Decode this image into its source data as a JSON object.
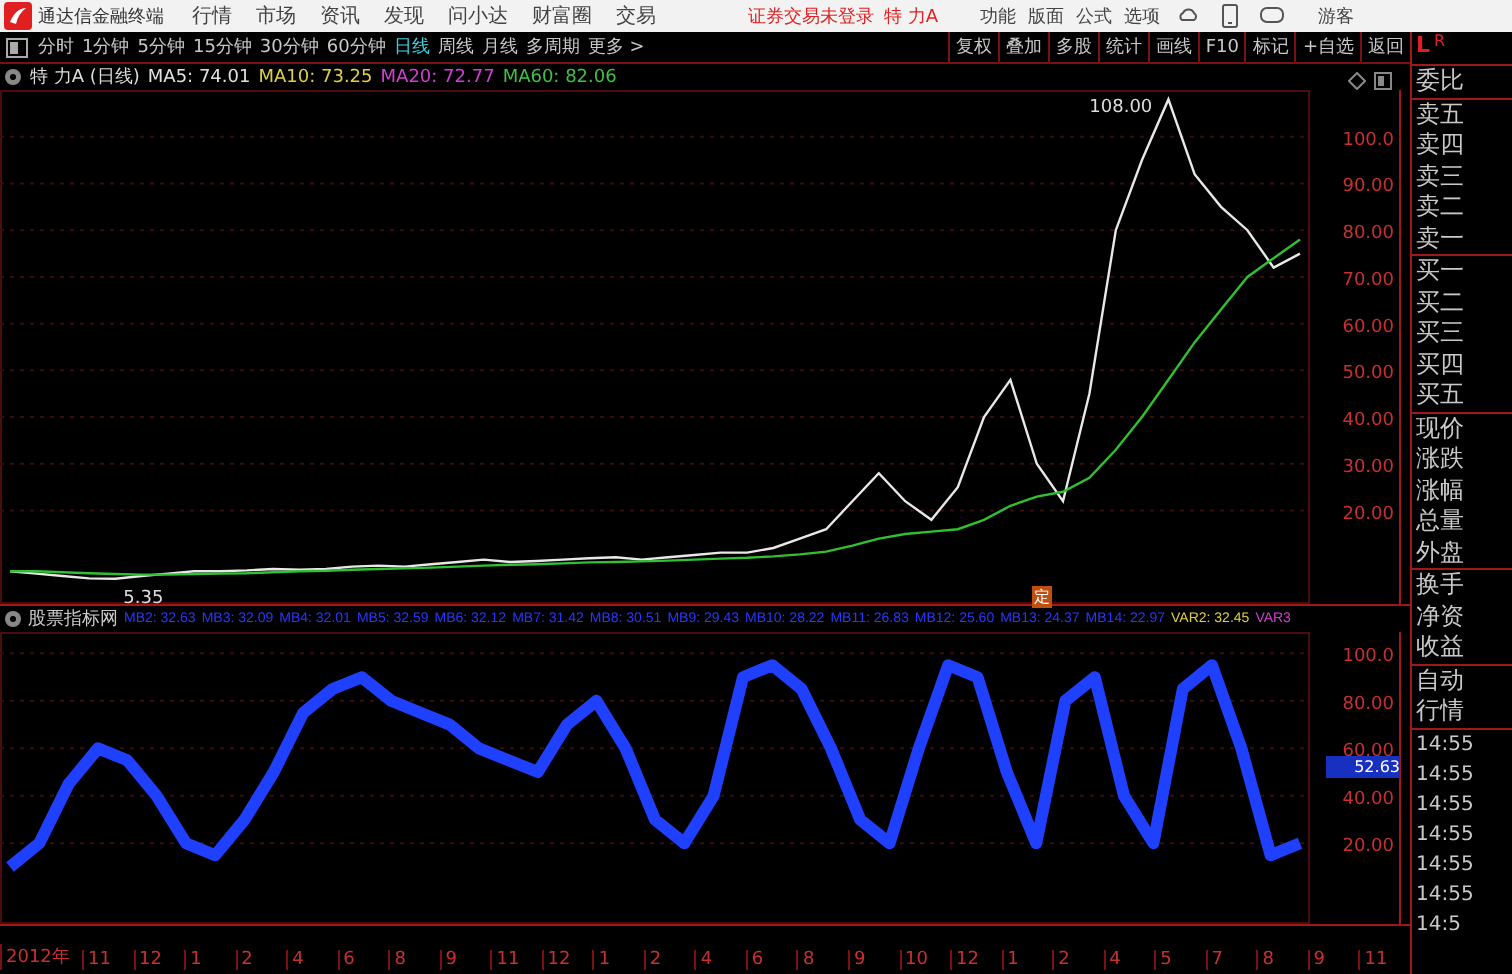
{
  "menubar": {
    "app_title": "通达信金融终端",
    "menu": [
      "行情",
      "市场",
      "资讯",
      "发现",
      "问小达",
      "财富圈",
      "交易"
    ],
    "notice": "证券交易未登录",
    "stock": "特 力A",
    "tools": [
      "功能",
      "版面",
      "公式",
      "选项"
    ],
    "user": "游客"
  },
  "toolbar": {
    "periods": [
      {
        "label": "分时",
        "selected": false
      },
      {
        "label": "1分钟",
        "selected": false
      },
      {
        "label": "5分钟",
        "selected": false
      },
      {
        "label": "15分钟",
        "selected": false
      },
      {
        "label": "30分钟",
        "selected": false
      },
      {
        "label": "60分钟",
        "selected": false
      },
      {
        "label": "日线",
        "selected": true
      },
      {
        "label": "周线",
        "selected": false
      },
      {
        "label": "月线",
        "selected": false
      },
      {
        "label": "多周期",
        "selected": false
      },
      {
        "label": "更多 >",
        "selected": false
      }
    ],
    "buttons": [
      "复权",
      "叠加",
      "多股",
      "统计",
      "画线",
      "F10",
      "标记",
      "+自选",
      "返回"
    ]
  },
  "price_panel": {
    "title": "特 力A (日线)",
    "ma": [
      {
        "label": "MA5: 74.01",
        "color": "#e0e0e0"
      },
      {
        "label": "MA10: 73.25",
        "color": "#e0d040"
      },
      {
        "label": "MA20: 72.77",
        "color": "#d040d0"
      },
      {
        "label": "MA60: 82.06",
        "color": "#40c040"
      }
    ],
    "chart_data": {
      "type": "line",
      "grid": true,
      "ylim": [
        0,
        110
      ],
      "yticks": [
        {
          "value": 20,
          "label": "20.00"
        },
        {
          "value": 30,
          "label": "30.00"
        },
        {
          "value": 40,
          "label": "40.00"
        },
        {
          "value": 50,
          "label": "50.00"
        },
        {
          "value": 60,
          "label": "60.00"
        },
        {
          "value": 70,
          "label": "70.00"
        },
        {
          "value": 80,
          "label": "80.00"
        },
        {
          "value": 90,
          "label": "90.00"
        },
        {
          "value": 100,
          "label": "100.0"
        }
      ],
      "series": [
        {
          "color": "#e8e8e8",
          "values": [
            7,
            6.5,
            6,
            5.5,
            5.4,
            6,
            6.5,
            7,
            7,
            7.2,
            7.5,
            7.3,
            7.5,
            8,
            8.2,
            8,
            8.5,
            9,
            9.5,
            9,
            9.2,
            9.5,
            9.8,
            10,
            9.5,
            10,
            10.5,
            11,
            11,
            12,
            14,
            16,
            22,
            28,
            22,
            18,
            25,
            40,
            48,
            30,
            22,
            45,
            80,
            95,
            108,
            92,
            85,
            80,
            72,
            75
          ]
        },
        {
          "color": "#30c030",
          "values": [
            7,
            7,
            6.8,
            6.6,
            6.4,
            6.3,
            6.3,
            6.4,
            6.5,
            6.6,
            6.8,
            7,
            7.1,
            7.3,
            7.5,
            7.6,
            7.8,
            8,
            8.2,
            8.4,
            8.5,
            8.7,
            8.9,
            9,
            9.1,
            9.3,
            9.5,
            9.7,
            9.9,
            10.2,
            10.6,
            11.2,
            12.5,
            14,
            15,
            15.5,
            16,
            18,
            21,
            23,
            24,
            27,
            33,
            40,
            48,
            56,
            63,
            70,
            74,
            78
          ]
        }
      ],
      "annotations": [
        "108.00",
        "5.35"
      ]
    }
  },
  "indicator_panel": {
    "name": "股票指标网",
    "marker": "定",
    "values": [
      {
        "label": "MB2: 32.63",
        "kind": "mb"
      },
      {
        "label": "MB3: 32.09",
        "kind": "mb"
      },
      {
        "label": "MB4: 32.01",
        "kind": "mb"
      },
      {
        "label": "MB5: 32.59",
        "kind": "mb"
      },
      {
        "label": "MB6: 32.12",
        "kind": "mb"
      },
      {
        "label": "MB7: 31.42",
        "kind": "mb"
      },
      {
        "label": "MB8: 30.51",
        "kind": "mb"
      },
      {
        "label": "MB9: 29.43",
        "kind": "mb"
      },
      {
        "label": "MB10: 28.22",
        "kind": "mb"
      },
      {
        "label": "MB11: 26.83",
        "kind": "mb"
      },
      {
        "label": "MB12: 25.60",
        "kind": "mb"
      },
      {
        "label": "MB13: 24.37",
        "kind": "mb"
      },
      {
        "label": "MB14: 22.97",
        "kind": "mb"
      },
      {
        "label": "VAR2: 32.45",
        "kind": "var2"
      },
      {
        "label": "VAR3",
        "kind": "var3"
      }
    ],
    "readout": "52.63",
    "chart_data": {
      "type": "line",
      "grid": true,
      "ylim": [
        -14,
        109
      ],
      "yticks": [
        {
          "value": 20,
          "label": "20.00"
        },
        {
          "value": 40,
          "label": "40.00"
        },
        {
          "value": 60,
          "label": "60.00"
        },
        {
          "value": 80,
          "label": "80.00"
        },
        {
          "value": 100,
          "label": "100.0"
        }
      ],
      "series": [
        {
          "color": "#2040ff",
          "values": [
            10,
            20,
            45,
            60,
            55,
            40,
            20,
            15,
            30,
            50,
            75,
            85,
            90,
            80,
            75,
            70,
            60,
            55,
            50,
            70,
            80,
            60,
            30,
            20,
            40,
            90,
            95,
            85,
            60,
            30,
            20,
            60,
            95,
            90,
            50,
            20,
            80,
            90,
            40,
            20,
            85,
            95,
            60,
            15,
            20
          ]
        }
      ]
    }
  },
  "date_axis": [
    "2012年",
    "11",
    "12",
    "1",
    "2",
    "4",
    "6",
    "8",
    "9",
    "11",
    "12",
    "1",
    "2",
    "4",
    "6",
    "8",
    "9",
    "10",
    "12",
    "1",
    "2",
    "4",
    "5",
    "7",
    "8",
    "9",
    "11"
  ],
  "side_panel": {
    "header": [
      "L",
      "R"
    ],
    "groups": [
      [
        "委比"
      ],
      [
        "卖五",
        "卖四",
        "卖三",
        "卖二",
        "卖一"
      ],
      [
        "买一",
        "买二",
        "买三",
        "买四",
        "买五"
      ],
      [
        "现价",
        "涨跌",
        "涨幅",
        "总量",
        "外盘"
      ],
      [
        "换手",
        "净资",
        "收益"
      ],
      [
        "自动",
        "行情"
      ]
    ],
    "times": [
      "14:55",
      "14:55",
      "14:55",
      "14:55",
      "14:55",
      "14:55",
      "14:5"
    ]
  }
}
